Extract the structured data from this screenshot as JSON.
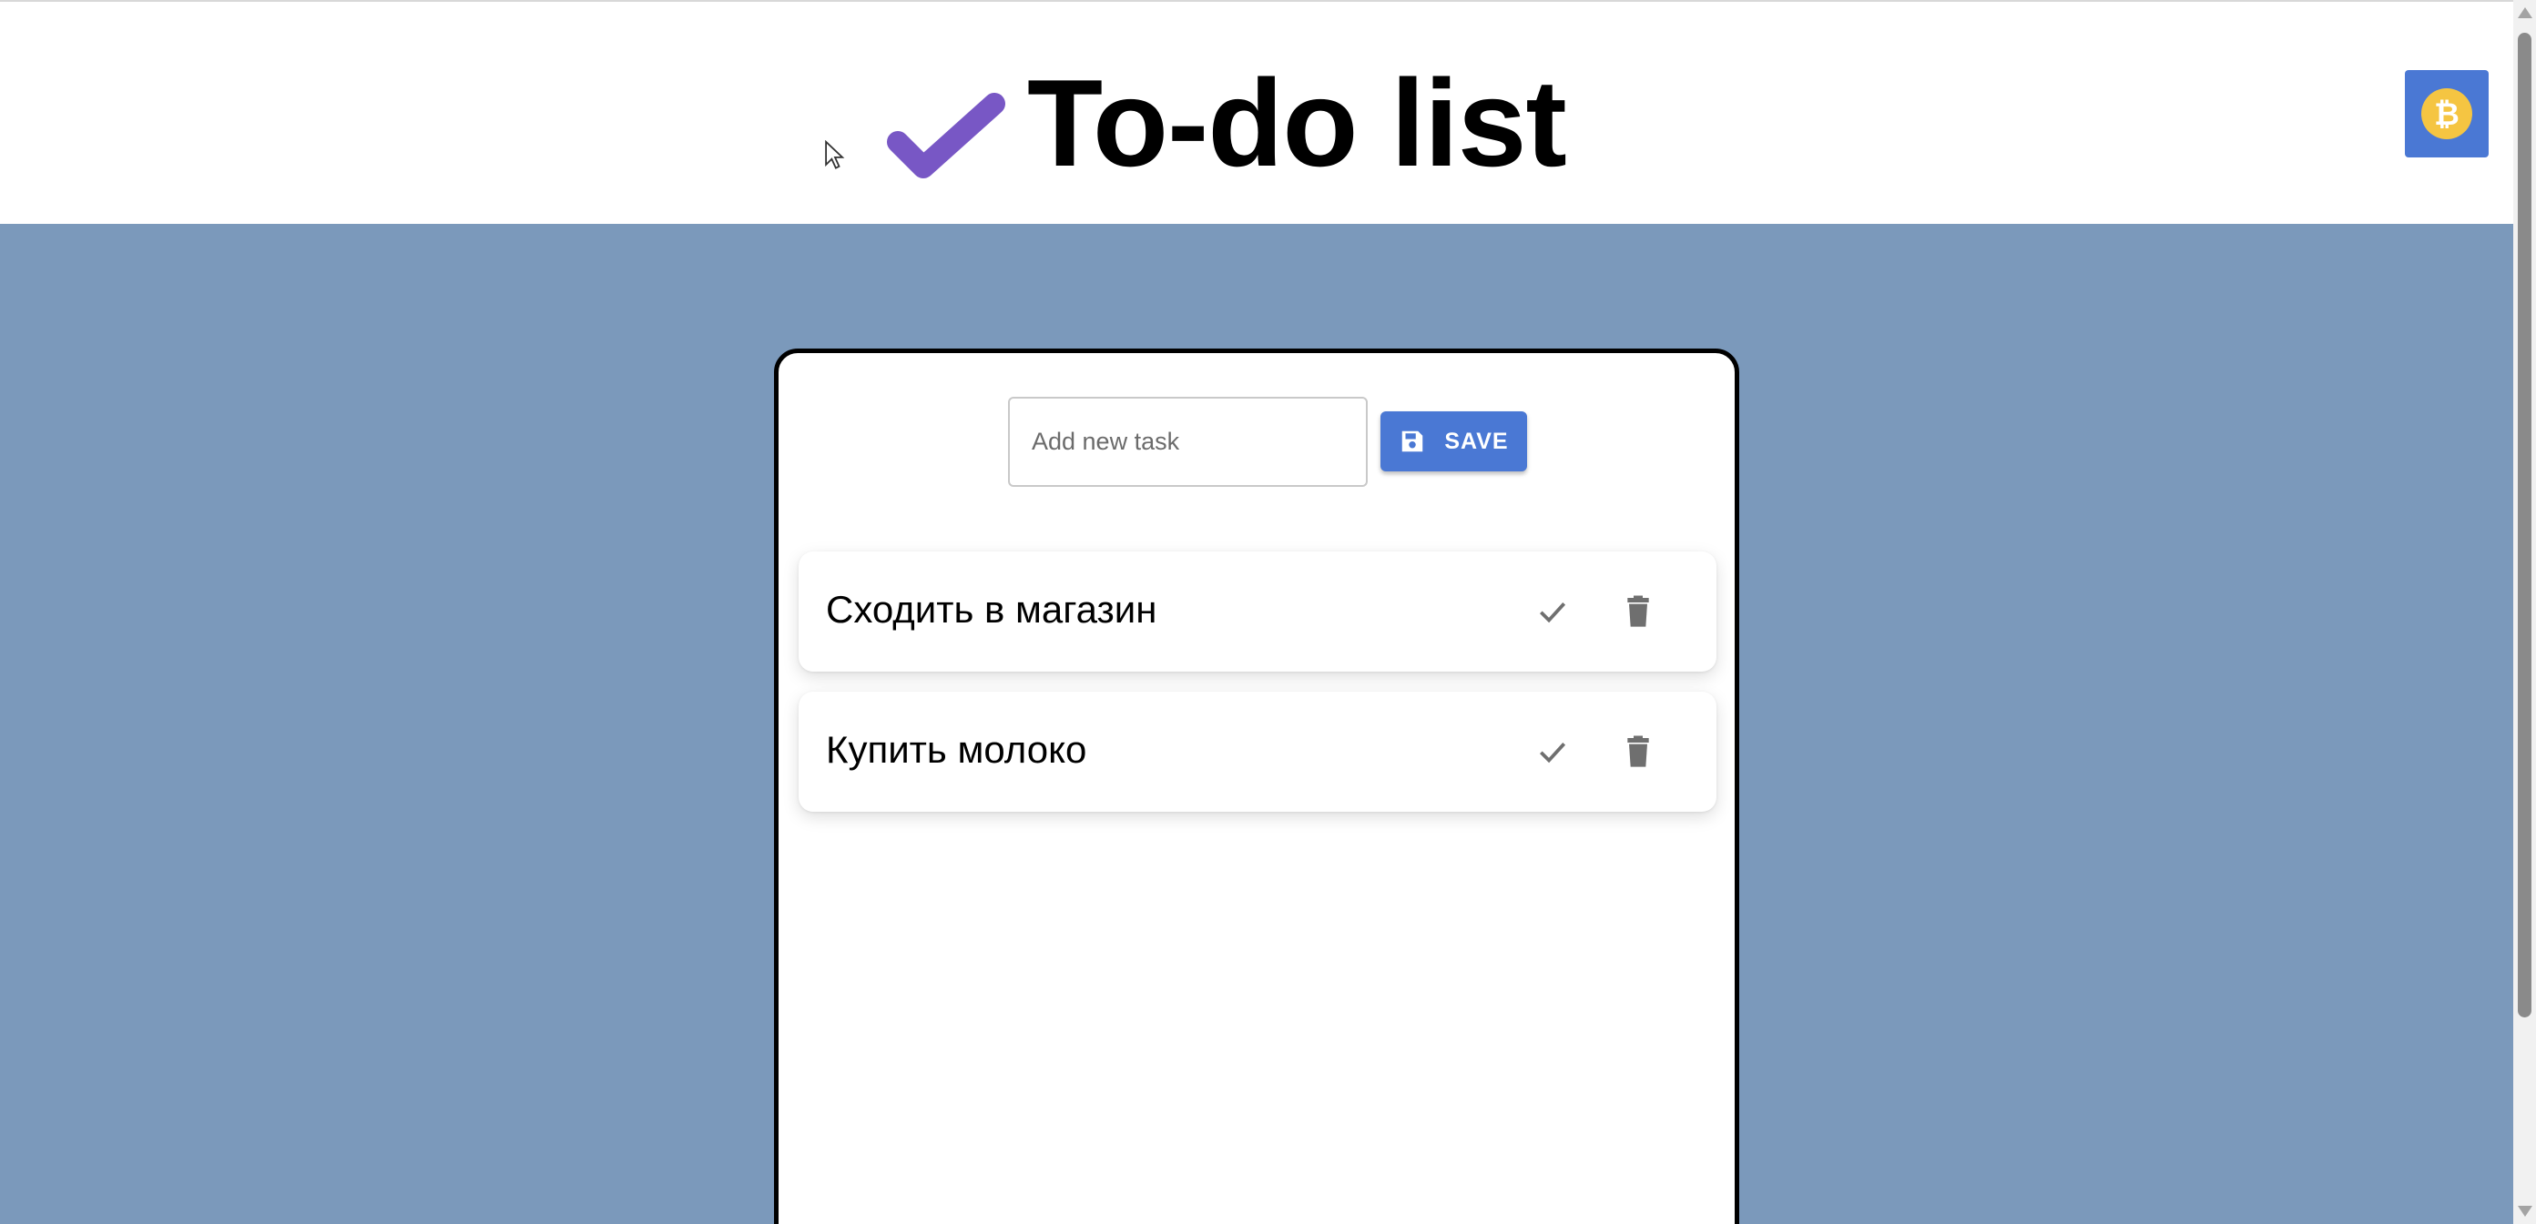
{
  "header": {
    "title": "To-do list",
    "title_icon": "check-icon",
    "title_icon_color": "#7857c5",
    "action_icon": "bitcoin-icon",
    "action_button_color": "#4a78d4",
    "bitcoin_color": "#f5c542"
  },
  "form": {
    "input_placeholder": "Add new task",
    "input_value": "",
    "save_label": "SAVE",
    "save_icon": "floppy-disk-icon"
  },
  "tasks": [
    {
      "text": "Сходить в магазин",
      "done_icon": "check-icon",
      "delete_icon": "trash-icon"
    },
    {
      "text": "Купить молоко",
      "done_icon": "check-icon",
      "delete_icon": "trash-icon"
    }
  ],
  "colors": {
    "background": "#7b99bb",
    "accent": "#4a78d4",
    "card_border": "#000000",
    "icon_gray": "#6f6f6f"
  }
}
